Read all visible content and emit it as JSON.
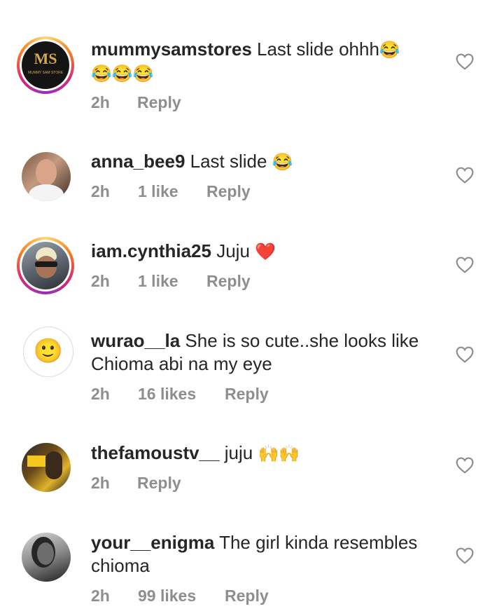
{
  "comments": [
    {
      "username": "mummysamstores",
      "text": "Last slide ohhh",
      "emoji": "😂",
      "emoji2": "😂😂😂",
      "time": "2h",
      "likes": "",
      "reply": "Reply",
      "avatar_text": "MS",
      "avatar_sub": "MUMMY SAM STORE"
    },
    {
      "username": "anna_bee9",
      "text": "Last slide",
      "emoji": "😂",
      "time": "2h",
      "likes": "1 like",
      "reply": "Reply"
    },
    {
      "username": "iam.cynthia25",
      "text": "Juju",
      "emoji": "❤️",
      "time": "2h",
      "likes": "1 like",
      "reply": "Reply"
    },
    {
      "username": "wurao__la",
      "text": "She is so cute..she looks like",
      "text2": "Chioma abi na my eye",
      "time": "2h",
      "likes": "16 likes",
      "reply": "Reply",
      "avatar_emoji": "🙂"
    },
    {
      "username": "thefamoustv__",
      "text": "juju",
      "emoji": "🙌🙌",
      "time": "2h",
      "likes": "",
      "reply": "Reply"
    },
    {
      "username": "your__enigma",
      "text": "The girl kinda resembles",
      "text2": "chioma",
      "time": "2h",
      "likes": "99 likes",
      "reply": "Reply"
    }
  ],
  "colors": {
    "story_ring": "#d62976",
    "username": "#262626",
    "meta": "#8e8e8e"
  },
  "icons": {
    "like": "heart-outline-icon"
  }
}
